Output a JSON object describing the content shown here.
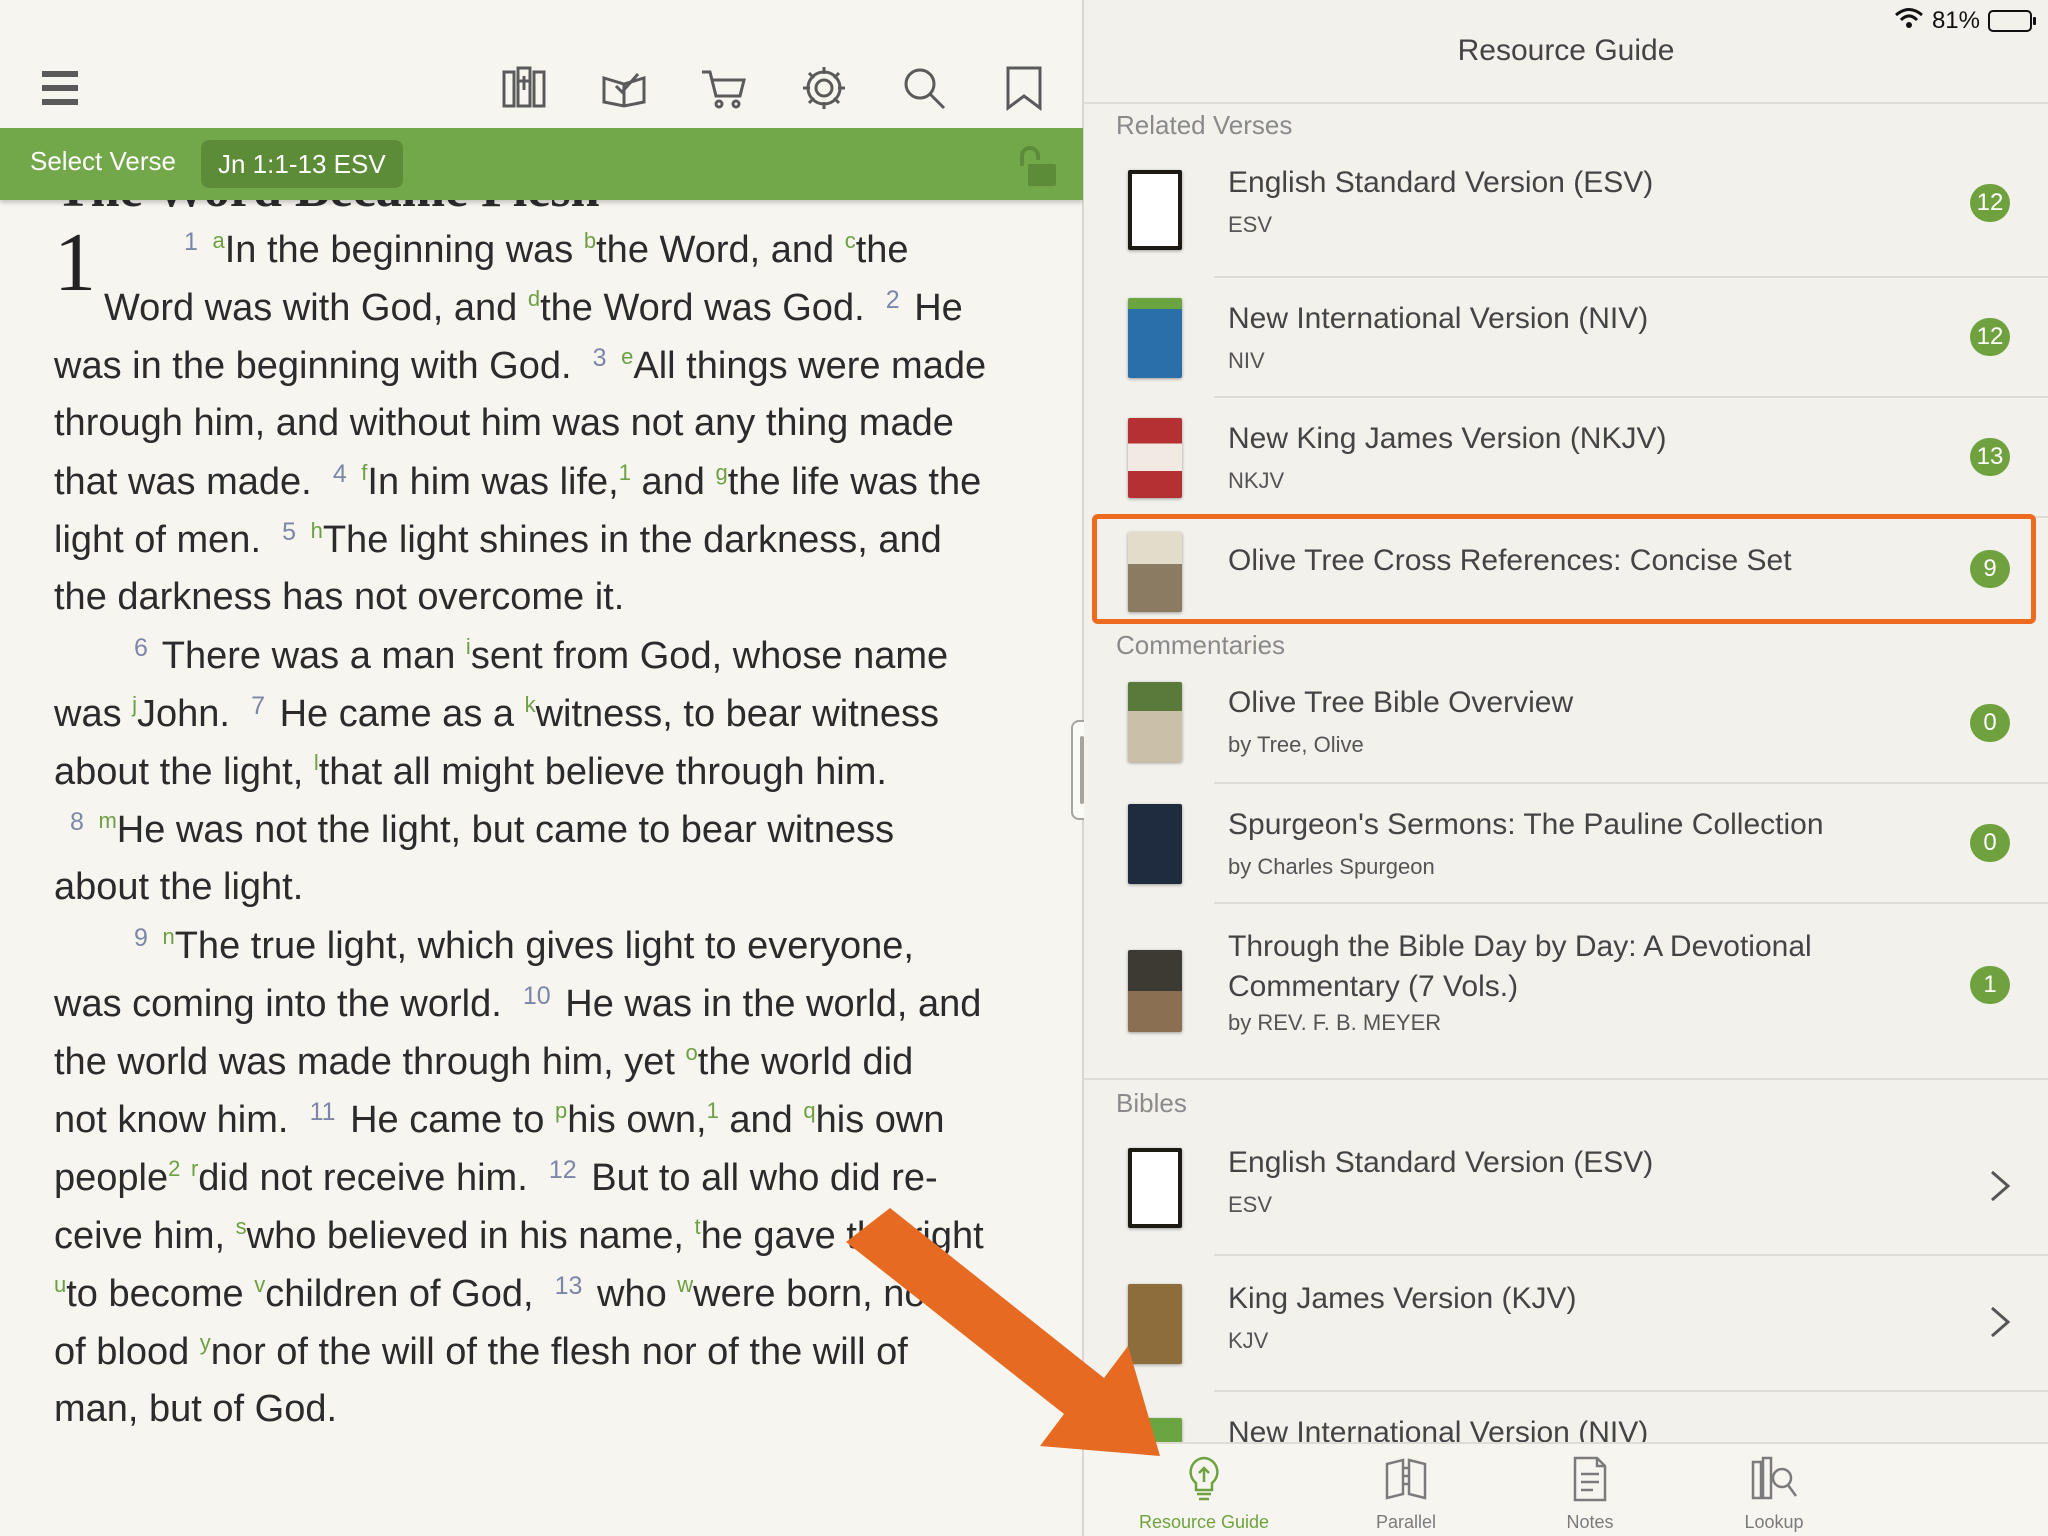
{
  "toolbar": {
    "icons": [
      "menu-icon",
      "library-icon",
      "reading-plan-icon",
      "store-cart-icon",
      "settings-gear-icon",
      "search-icon",
      "bookmark-icon"
    ]
  },
  "verse_bar": {
    "select_label": "Select Verse",
    "reference": "Jn 1:1-13 ESV"
  },
  "passage": {
    "heading": "The Word Became Flesh",
    "chapter": "1"
  },
  "status": {
    "battery": "81%",
    "battery_level": 0.81
  },
  "resource_guide": {
    "title": "Resource Guide",
    "sections": {
      "related_verses": "Related Verses",
      "commentaries": "Commentaries",
      "bibles": "Bibles"
    },
    "related_verses": [
      {
        "title": "English Standard Version (ESV)",
        "subtitle": "ESV",
        "count": "12"
      },
      {
        "title": "New International Version (NIV)",
        "subtitle": "NIV",
        "count": "12"
      },
      {
        "title": "New King James Version (NKJV)",
        "subtitle": "NKJV",
        "count": "13"
      },
      {
        "title": "Olive Tree Cross References: Concise Set",
        "subtitle": "",
        "count": "9"
      }
    ],
    "commentaries": [
      {
        "title": "Olive Tree Bible Overview",
        "subtitle": "by Tree, Olive",
        "count": "0"
      },
      {
        "title": "Spurgeon's Sermons: The Pauline Collection",
        "subtitle": "by Charles Spurgeon",
        "count": "0"
      },
      {
        "title_line1": "Through the Bible Day by Day: A Devotional",
        "title_line2": "Commentary (7 Vols.)",
        "subtitle": "by REV. F. B. MEYER",
        "count": "1"
      }
    ],
    "bibles": [
      {
        "title": "English Standard Version (ESV)",
        "subtitle": "ESV"
      },
      {
        "title": "King James Version (KJV)",
        "subtitle": "KJV"
      },
      {
        "title": "New International Version (NIV)",
        "subtitle": ""
      }
    ]
  },
  "tabs": [
    {
      "label": "Resource Guide",
      "active": true
    },
    {
      "label": "Parallel",
      "active": false
    },
    {
      "label": "Notes",
      "active": false
    },
    {
      "label": "Lookup",
      "active": false
    }
  ],
  "colors": {
    "accent_green": "#72a74a",
    "badge_green": "#6fa23f",
    "highlight_orange": "#ec6b1f"
  }
}
